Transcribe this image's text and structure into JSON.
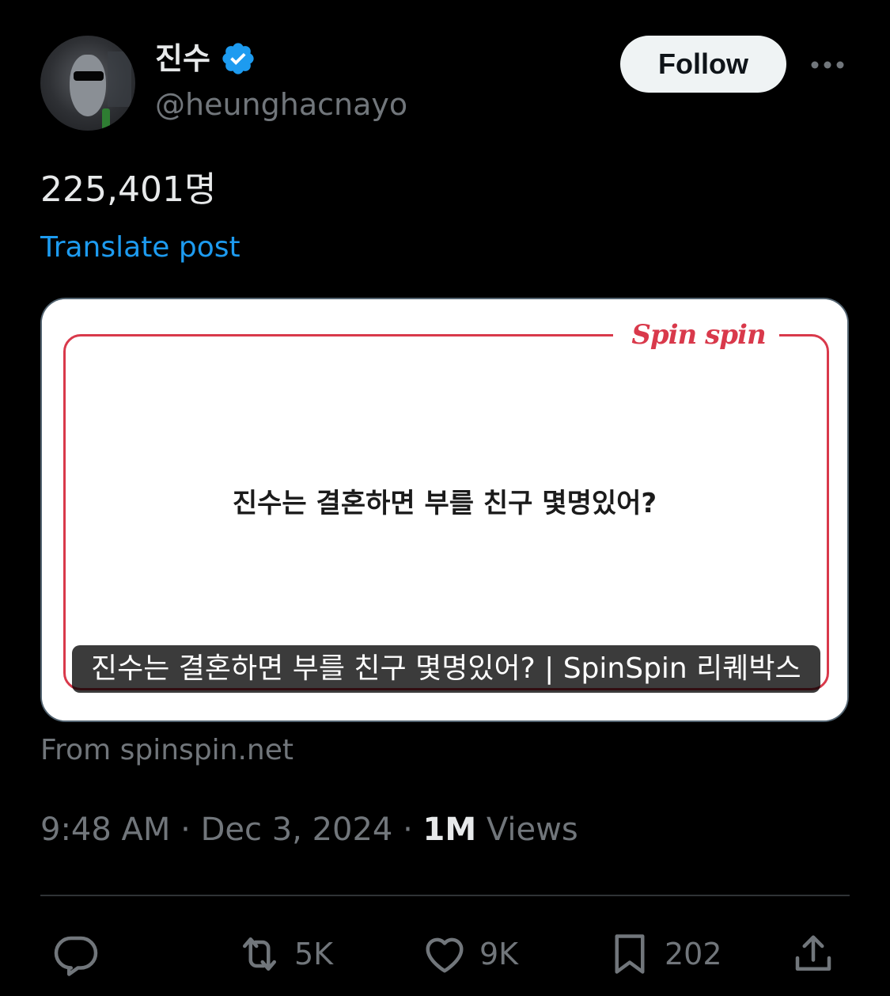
{
  "author": {
    "display_name": "진수",
    "handle": "@heunghacnayo",
    "verified_badge": "verified-check-icon",
    "verified_color": "#1d9bf0"
  },
  "header": {
    "follow_label": "Follow",
    "more_icon": "more-horizontal-icon"
  },
  "post": {
    "text": "225,401명",
    "translate_label": "Translate post"
  },
  "card": {
    "brand": "Spin spin",
    "question": "진수는 결혼하면 부를 친구 몇명있어?",
    "caption": "진수는 결혼하면 부를 친구 몇명있어? | SpinSpin 리퀘박스",
    "source": "From spinspin.net",
    "accent_color": "#d9394b"
  },
  "meta": {
    "time": "9:48 AM",
    "separator": "·",
    "date": "Dec 3, 2024",
    "views_count": "1M",
    "views_label": "Views"
  },
  "actions": {
    "reply": {
      "icon": "reply-icon",
      "count": ""
    },
    "repost": {
      "icon": "repost-icon",
      "count": "5K"
    },
    "like": {
      "icon": "heart-icon",
      "count": "9K"
    },
    "bookmark": {
      "icon": "bookmark-icon",
      "count": "202"
    },
    "share": {
      "icon": "share-icon"
    }
  }
}
